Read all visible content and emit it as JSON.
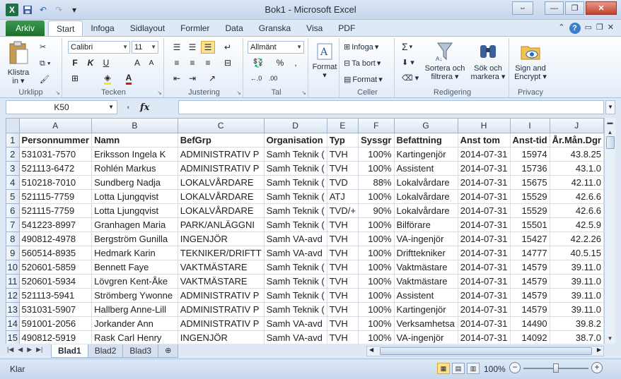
{
  "window": {
    "title": "Bok1  -  Microsoft Excel",
    "minimize": "—",
    "maximize": "❐",
    "close": "✕",
    "restore_extra": "⇔"
  },
  "qat": {
    "app_icon": "X",
    "save_icon": "💾",
    "undo_icon": "↶",
    "redo_icon": "↷",
    "customize_icon": "▾"
  },
  "ribbon": {
    "file_tab": "Arkiv",
    "tabs": [
      "Start",
      "Infoga",
      "Sidlayout",
      "Formler",
      "Data",
      "Granska",
      "Visa",
      "PDF"
    ],
    "active_tab": "Start",
    "groups": {
      "clipboard": {
        "label": "Urklipp",
        "paste": "Klistra\nin ▾"
      },
      "font": {
        "label": "Tecken",
        "font_name": "Calibri",
        "font_size": "11",
        "bold": "F",
        "italic": "K",
        "underline": "U",
        "grow": "A",
        "shrink": "A"
      },
      "alignment": {
        "label": "Justering"
      },
      "number": {
        "label": "Tal",
        "format": "Allmänt",
        "percent": "%",
        "thousands": ",",
        "currency": "$"
      },
      "styles": {
        "label": "",
        "format": "Format"
      },
      "cells": {
        "label": "Celler",
        "insert": "Infoga",
        "delete": "Ta bort",
        "format": "Format"
      },
      "editing": {
        "label": "Redigering",
        "sigma": "Σ",
        "sort": "Sortera och\nfiltrera ▾",
        "find": "Sök och\nmarkera ▾"
      },
      "privacy": {
        "label": "Privacy",
        "sign": "Sign and\nEncrypt ▾"
      }
    }
  },
  "formula_bar": {
    "name_box": "K50",
    "fx": "fx",
    "formula": ""
  },
  "sheet": {
    "columns": [
      "A",
      "B",
      "C",
      "D",
      "E",
      "F",
      "G",
      "H",
      "I",
      "J"
    ],
    "header_row": [
      "Personnummer",
      "Namn",
      "BefGrp",
      "Organisation",
      "Typ",
      "Syssgr",
      "Befattning",
      "Anst tom",
      "Anst-tid",
      "År.Mån.Dgr"
    ],
    "rows": [
      [
        "531031-7570",
        "Eriksson Ingela K",
        "ADMINISTRATIV P",
        "Samh Teknik (",
        "TVH",
        "100%",
        "Kartingenjör",
        "2014-07-31",
        "15974",
        "43.8.25"
      ],
      [
        "521113-6472",
        "Rohlén Markus",
        "ADMINISTRATIV P",
        "Samh Teknik (",
        "TVH",
        "100%",
        "Assistent",
        "2014-07-31",
        "15736",
        "43.1.0"
      ],
      [
        "510218-7010",
        "Sundberg Nadja",
        "LOKALVÅRDARE",
        "Samh Teknik (",
        "TVD",
        "88%",
        "Lokalvårdare",
        "2014-07-31",
        "15675",
        "42.11.0"
      ],
      [
        "521115-7759",
        "Lotta Ljungqvist",
        "LOKALVÅRDARE",
        "Samh Teknik (",
        "ATJ",
        "100%",
        "Lokalvårdare",
        "2014-07-31",
        "15529",
        "42.6.6"
      ],
      [
        "521115-7759",
        "Lotta Ljungqvist",
        "LOKALVÅRDARE",
        "Samh Teknik (",
        "TVD/+",
        "90%",
        "Lokalvårdare",
        "2014-07-31",
        "15529",
        "42.6.6"
      ],
      [
        "541223-8997",
        "Granhagen Maria",
        "PARK/ANLÄGGNI",
        "Samh Teknik (",
        "TVH",
        "100%",
        "Bilförare",
        "2014-07-31",
        "15501",
        "42.5.9"
      ],
      [
        "490812-4978",
        "Bergström Gunilla",
        "INGENJÖR",
        "Samh VA-avd",
        "TVH",
        "100%",
        "VA-ingenjör",
        "2014-07-31",
        "15427",
        "42.2.26"
      ],
      [
        "560514-8935",
        "Hedmark Karin",
        "TEKNIKER/DRIFTT",
        "Samh VA-avd",
        "TVH",
        "100%",
        "Drifttekniker",
        "2014-07-31",
        "14777",
        "40.5.15"
      ],
      [
        "520601-5859",
        "Bennett Faye",
        "VAKTMÄSTARE",
        "Samh Teknik (",
        "TVH",
        "100%",
        "Vaktmästare",
        "2014-07-31",
        "14579",
        "39.11.0"
      ],
      [
        "520601-5934",
        "Lövgren Kent-Åke",
        "VAKTMÄSTARE",
        "Samh Teknik (",
        "TVH",
        "100%",
        "Vaktmästare",
        "2014-07-31",
        "14579",
        "39.11.0"
      ],
      [
        "521113-5941",
        "Strömberg Ywonne",
        "ADMINISTRATIV P",
        "Samh Teknik (",
        "TVH",
        "100%",
        "Assistent",
        "2014-07-31",
        "14579",
        "39.11.0"
      ],
      [
        "531031-5907",
        "Hallberg Anne-Lill",
        "ADMINISTRATIV P",
        "Samh Teknik (",
        "TVH",
        "100%",
        "Kartingenjör",
        "2014-07-31",
        "14579",
        "39.11.0"
      ],
      [
        "591001-2056",
        "Jorkander Ann",
        "ADMINISTRATIV P",
        "Samh VA-avd",
        "TVH",
        "100%",
        "Verksamhetsa",
        "2014-07-31",
        "14490",
        "39.8.2"
      ],
      [
        "490812-5919",
        "Rask Carl Henry",
        "INGENJÖR",
        "Samh VA-avd",
        "TVH",
        "100%",
        "VA-ingenjör",
        "2014-07-31",
        "14092",
        "38.7.0"
      ]
    ],
    "tabs": [
      "Blad1",
      "Blad2",
      "Blad3"
    ],
    "active_tab": "Blad1"
  },
  "status": {
    "text": "Klar",
    "zoom": "100%",
    "zoom_minus": "−",
    "zoom_plus": "+"
  }
}
